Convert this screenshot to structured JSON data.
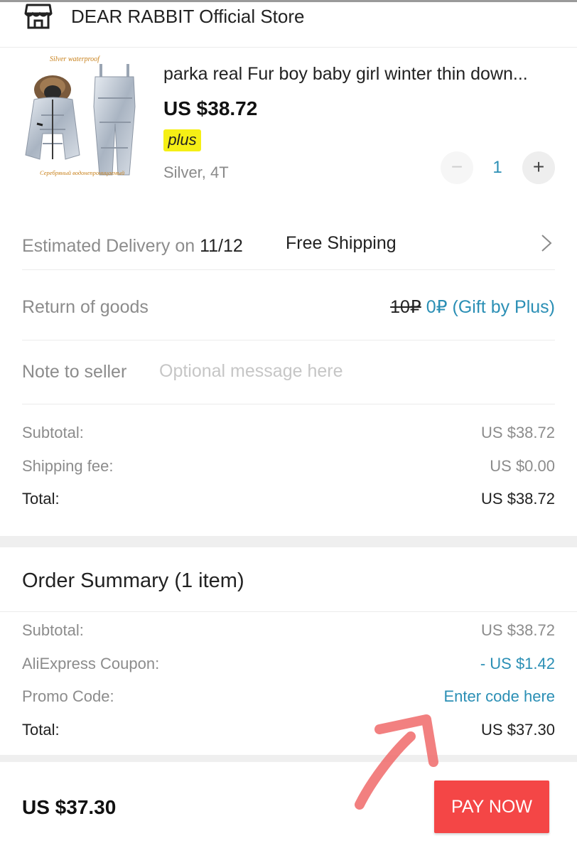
{
  "store": {
    "icon": "store-icon",
    "name": "DEAR RABBIT Official Store"
  },
  "product": {
    "image_caption_top": "Silver waterproof",
    "image_caption_bottom": "Серебряный водонепроницаемый",
    "title": "parka real Fur boy baby girl winter thin down...",
    "price": "US $38.72",
    "badge": "plus",
    "variant": "Silver, 4T",
    "quantity": "1",
    "minus_symbol": "−",
    "plus_symbol": "+"
  },
  "delivery": {
    "label": "Estimated Delivery on ",
    "date": "11/12",
    "shipping": "Free Shipping",
    "chevron_icon": "chevron-right-icon"
  },
  "returns": {
    "label": "Return of goods",
    "old_price": "10₽",
    "new_value": " 0₽ (Gift by Plus)"
  },
  "note": {
    "label": "Note to seller",
    "placeholder": "Optional message here"
  },
  "store_totals": {
    "subtotal_label": "Subtotal:",
    "subtotal_value": "US $38.72",
    "shipping_label": "Shipping fee:",
    "shipping_value": "US $0.00",
    "total_label": "Total:",
    "total_value": "US $38.72"
  },
  "order_summary": {
    "title": "Order Summary (1 item)",
    "subtotal_label": "Subtotal:",
    "subtotal_value": "US $38.72",
    "coupon_label": "AliExpress Coupon:",
    "coupon_value": "- US $1.42",
    "promo_label": "Promo Code:",
    "promo_value": "Enter code here",
    "total_label": "Total:",
    "total_value": "US $37.30"
  },
  "footer": {
    "total": "US $37.30",
    "pay_button": "PAY NOW"
  },
  "colors": {
    "accent_blue": "#2b8fb5",
    "pay_red": "#f44646",
    "plus_yellow": "#f5ef15",
    "annotation_arrow": "#f06a6a"
  }
}
